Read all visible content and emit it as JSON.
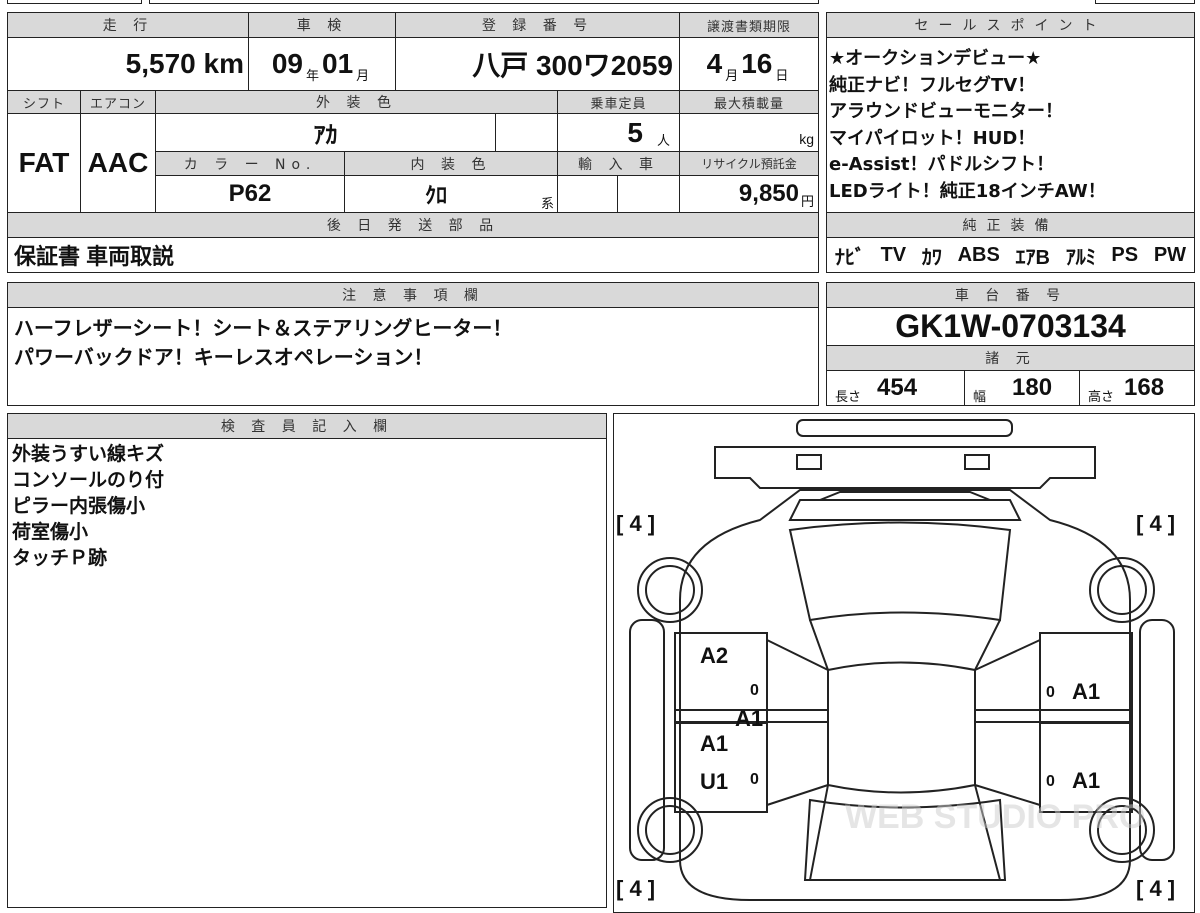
{
  "main": {
    "mileage_label": "走 行",
    "mileage": "5,570",
    "mileage_unit": "km",
    "inspection_label": "車 検",
    "insp_year": "09",
    "year_unit": "年",
    "insp_month": "01",
    "month_unit": "月",
    "reg_label": "登 録 番 号",
    "reg_number": "八戸 300ワ2059",
    "transfer_label": "譲渡書類期限",
    "transfer_month": "4",
    "transfer_month_unit": "月",
    "transfer_day": "16",
    "day_unit": "日",
    "shift_label": "シフト",
    "shift": "FAT",
    "ac_label": "エアコン",
    "ac": "AAC",
    "ext_color_label": "外 装 色",
    "ext_color": "ｱｶ",
    "capacity_label": "乗車定員",
    "capacity": "5",
    "capacity_unit": "人",
    "max_load_label": "最大積載量",
    "max_load_unit": "kg",
    "color_no_label": "カ ラ ー No.",
    "color_no": "P62",
    "int_color_label": "内 装 色",
    "int_color": "ｸﾛ",
    "int_color_unit": "系",
    "import_label": "輸 入 車",
    "recycle_label": "リサイクル預託金",
    "recycle": "9,850",
    "recycle_unit": "円",
    "later_parts_label": "後 日 発 送 部 品",
    "later_parts": "保証書 車両取説"
  },
  "sales": {
    "label": "セールスポイント",
    "lines": [
      "★オークションデビュー★",
      "純正ナビ！フルセグTV！",
      "アラウンドビューモニター！",
      "マイパイロット！HUD！",
      "e-Assist！パドルシフト！",
      "LEDライト！純正18インチAW！"
    ]
  },
  "equipment": {
    "label": "純正装備",
    "items": [
      "ﾅﾋﾞ",
      "TV",
      "ｶﾜ",
      "ABS",
      "ｴｱB",
      "ｱﾙﾐ",
      "PS",
      "PW"
    ]
  },
  "notes": {
    "label": "注 意 事 項 欄",
    "lines": [
      "ハーフレザーシート！シート＆ステアリングヒーター！",
      "パワーバックドア！キーレスオペレーション！"
    ]
  },
  "chassis": {
    "label": "車 台 番 号",
    "number": "GK1W-0703134"
  },
  "specs": {
    "label": "諸 元",
    "length_label": "長さ",
    "length": "454",
    "width_label": "幅",
    "width": "180",
    "height_label": "高さ",
    "height": "168"
  },
  "inspector": {
    "label": "検 査 員 記 入 欄",
    "lines": [
      "外装うすい線キズ",
      "コンソールのり付",
      "ピラー内張傷小",
      "荷室傷小",
      "タッチＰ跡"
    ]
  },
  "diagram": {
    "tire_fl": "[ 4 ]",
    "tire_fr": "[ 4 ]",
    "tire_rl": "[ 4 ]",
    "tire_rr": "[ 4 ]",
    "marks": {
      "l1": "A2",
      "l1z": "0",
      "l_mid": "A1",
      "l2": "A1",
      "l3": "U1",
      "l3z": "0",
      "r1z": "0",
      "r1": "A1",
      "r2z": "0",
      "r2": "A1"
    },
    "watermark": "WEB STUDIO PRO"
  }
}
